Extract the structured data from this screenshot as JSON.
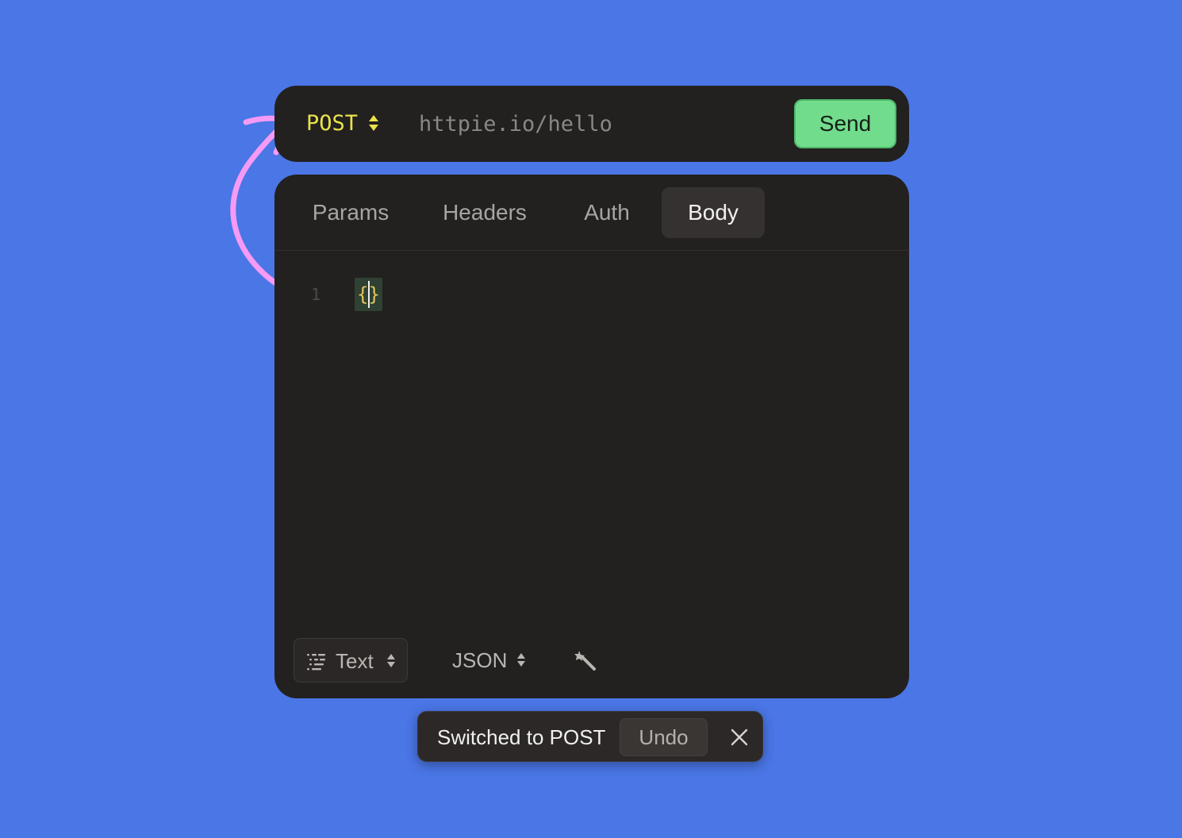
{
  "request": {
    "method": "POST",
    "url_placeholder": "httpie.io/hello",
    "send_label": "Send"
  },
  "tabs": [
    {
      "label": "Params",
      "active": false
    },
    {
      "label": "Headers",
      "active": false
    },
    {
      "label": "Auth",
      "active": false
    },
    {
      "label": "Body",
      "active": true
    }
  ],
  "editor": {
    "line_number": "1",
    "content": "{}"
  },
  "footer": {
    "format_label": "Text",
    "language_label": "JSON",
    "format_icon": "list-lines-icon",
    "magic_icon": "magic-wand-icon"
  },
  "toast": {
    "message": "Switched to POST",
    "undo_label": "Undo"
  },
  "colors": {
    "background": "#4a76e6",
    "panel": "#232020",
    "method": "#e9e34a",
    "send": "#72dc8d",
    "annotation_arrow": "#f59af5"
  }
}
